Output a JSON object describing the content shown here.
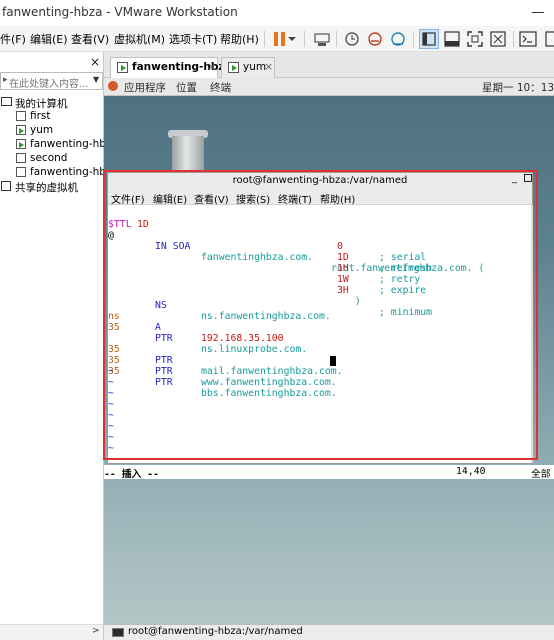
{
  "window": {
    "title": "fanwenting-hbza - VMware Workstation"
  },
  "menu": {
    "items": [
      "件(F)",
      "编辑(E)",
      "查看(V)",
      "虚拟机(M)",
      "选项卡(T)",
      "帮助(H)"
    ]
  },
  "sidebar": {
    "close_glyph": "×",
    "search_placeholder": "在此处键入内容...",
    "tree": {
      "my_computer": "我的计算机",
      "vms": [
        "first",
        "yum",
        "fanwenting-hbz",
        "second",
        "fanwenting-hbz"
      ],
      "shared": "共享的虚拟机"
    }
  },
  "tabs": [
    {
      "label": "fanwenting-hbza",
      "close": "×"
    },
    {
      "label": "yum",
      "close": "×"
    }
  ],
  "guest": {
    "panel": {
      "applications": "应用程序",
      "places": "位置",
      "terminal": "终端",
      "clock": "星期一 10：13"
    },
    "terminal": {
      "title": "root@fanwenting-hbza:/var/named",
      "menu": [
        "文件(F)",
        "编辑(E)",
        "查看(V)",
        "搜索(S)",
        "终端(T)",
        "帮助(H)"
      ],
      "lines": {
        "l1a": "$TTL ",
        "l1b": "1D",
        "l2a": "@",
        "l2b": "IN SOA",
        "l2c": "fanwentinghbza.com.",
        "l2d": "root.fanwentinghbza.com. (",
        "l3a": "0",
        "l3b": "; serial",
        "l4a": "1D",
        "l4b": "; refresh",
        "l5a": "1H",
        "l5b": "; retry",
        "l6a": "1W",
        "l6b": "; expire",
        "l7a": "3H",
        "l7b": " )",
        "l7c": "; minimum",
        "l8a": "NS",
        "l8b": "ns.fanwentinghbza.com.",
        "l9a": "ns",
        "l9b": "A",
        "l9c": "192.168.35.100",
        "l10a": "35",
        "l10b": "PTR",
        "l10c": "ns.linuxprobe.com.",
        "l11a": "35",
        "l11b": "PTR",
        "l11c": "mail.fanwentinghbza.com.",
        "l12a": "35",
        "l12b": "PTR",
        "l12c": "www.fanwentinghbza.com.",
        "l13a": "35",
        "l13b": "PTR",
        "l13c": "bbs.fanwentinghbza.com.",
        "tilde": "~"
      }
    },
    "vim_status": {
      "mode": "-- 插入 --",
      "position": "14,40",
      "scroll": "全部"
    },
    "taskbar_item": "root@fanwenting-hbza:/var/named"
  },
  "colors": {
    "highlight_box": "#e03030",
    "tab_vm_running": "#2e9b2e"
  }
}
